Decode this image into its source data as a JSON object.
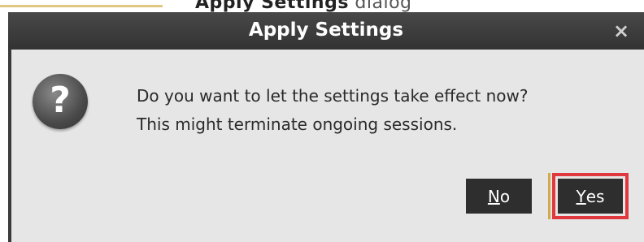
{
  "backdrop": {
    "fragment_bold": "Apply Settings",
    "fragment_normal": " dialog"
  },
  "dialog": {
    "title": "Apply Settings",
    "close_glyph": "×",
    "icon": "question-icon",
    "icon_glyph": "?",
    "message_line1": "Do you want to let the settings take effect now?",
    "message_line2": "This might terminate ongoing sessions.",
    "buttons": {
      "no": {
        "mnemonic": "N",
        "rest": "o"
      },
      "yes": {
        "mnemonic": "Y",
        "rest": "es"
      }
    },
    "highlight_color": "#e0383e"
  }
}
